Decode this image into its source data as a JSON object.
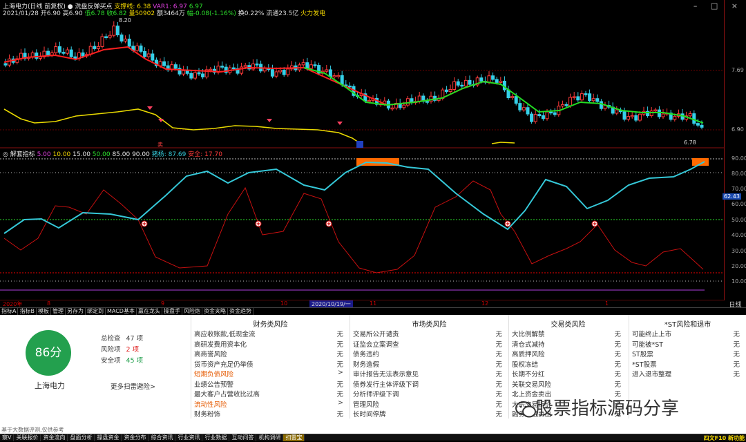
{
  "header": {
    "stock_title": "上海电力(日线 前复权)",
    "indicator1_name": "● 洗盘反弹买点",
    "support_label": "支撑线: 6.38",
    "var1_label": "VAR1: 6.97",
    "var1_value": "6.97",
    "date": "2021/01/28",
    "open": "开6.90",
    "high": "高6.90",
    "low": "低6.78",
    "close": "收6.82",
    "volume": "量50902",
    "amount": "额3464万",
    "change": "幅-0.08(-1.16%)",
    "turnover": "换0.22%",
    "float": "流通23.5亿",
    "news": "火力发电"
  },
  "window_buttons": "– □ ×",
  "price_chart": {
    "y_labels": [
      "7.69",
      "6.90"
    ],
    "high_label": "8.20",
    "low_label": "6.78",
    "axis_top": "90.00",
    "cursor_value": "62.43"
  },
  "indicator_title": {
    "name": "◎ 解套指标",
    "params": [
      "5.00",
      "10.00",
      "15.00",
      "50.00",
      "85.00",
      "90.00"
    ],
    "huanggen_label": "猪杨: 87.69",
    "anquan_label": "安全: 17.70"
  },
  "indicator_axis": [
    "90.00",
    "80.00",
    "70.00",
    "60.00",
    "50.00",
    "40.00",
    "30.00",
    "20.00",
    "10.00"
  ],
  "position_row": {
    "labels": [
      "2020年",
      "8",
      "9",
      "10",
      "11",
      "12",
      "1"
    ],
    "highlight": "2020/10/19/一",
    "day_button": "日线"
  },
  "tabs": [
    "指标A",
    "指标B",
    "模板",
    "管理",
    "另存为",
    "绑定到",
    "MACD基本",
    "赢在龙头",
    "操盘手",
    "风险炮",
    "资金夹略",
    "资金趋势"
  ],
  "risk_panel": {
    "score": "86分",
    "stock_name": "上海电力",
    "total_label": "总检查",
    "total_value": "47 项",
    "risk_label": "风险项",
    "risk_value": "2 项",
    "safe_label": "安全项",
    "safe_value": "45 项",
    "more_link": "更多扫雷避险>",
    "disclaimer": "基于大数据评测,仅供参考",
    "columns": [
      {
        "title": "财务类风险",
        "rows": [
          {
            "label": "高应收账款,低现金流",
            "value": "无"
          },
          {
            "label": "高研发费用资本化",
            "value": "无"
          },
          {
            "label": "高商誉风险",
            "value": "无"
          },
          {
            "label": "货币资产充足仍举债",
            "value": "无"
          },
          {
            "label": "短期负债风险",
            "value": ">",
            "warn": true
          },
          {
            "label": "业绩公告预警",
            "value": "无"
          },
          {
            "label": "最大客户占营收比过高",
            "value": "无"
          },
          {
            "label": "流动性风险",
            "value": ">",
            "warn": true
          },
          {
            "label": "财务粉饰",
            "value": "无"
          }
        ]
      },
      {
        "title": "市场类风险",
        "rows": [
          {
            "label": "交易所公开谴责",
            "value": "无"
          },
          {
            "label": "证监会立案调查",
            "value": "无"
          },
          {
            "label": "债务违约",
            "value": "无"
          },
          {
            "label": "财务造假",
            "value": "无"
          },
          {
            "label": "审计报告无法表示意见",
            "value": "无"
          },
          {
            "label": "债券发行主体评级下调",
            "value": "无"
          },
          {
            "label": "分析师评级下调",
            "value": "无"
          },
          {
            "label": "管理风险",
            "value": "无"
          },
          {
            "label": "长时间停牌",
            "value": "无"
          }
        ]
      },
      {
        "title": "交易类风险",
        "rows": [
          {
            "label": "大比例解禁",
            "value": "无"
          },
          {
            "label": "清仓式减持",
            "value": "无"
          },
          {
            "label": "高质押风险",
            "value": "无"
          },
          {
            "label": "股权冻结",
            "value": "无"
          },
          {
            "label": "长期不分红",
            "value": "无"
          },
          {
            "label": "关联交易风险",
            "value": "无"
          },
          {
            "label": "北上资金卖出",
            "value": "无"
          },
          {
            "label": "大宗交易折价",
            "value": "无"
          },
          {
            "label": "融券高融卖出",
            "value": "无"
          }
        ]
      },
      {
        "title": "*ST风险和退市",
        "rows": [
          {
            "label": "可能终止上市",
            "value": "无"
          },
          {
            "label": "可能被*ST",
            "value": "无"
          },
          {
            "label": "ST股票",
            "value": "无"
          },
          {
            "label": "*ST股票",
            "value": "无"
          },
          {
            "label": "进入退市整理",
            "value": "无"
          }
        ]
      }
    ]
  },
  "watermark": "股票指标源码分享",
  "bottom_tabs": [
    "察V",
    "关联报价",
    "资金流向",
    "盘面分析",
    "操盘资金",
    "资金分布",
    "综合资讯",
    "行业资讯",
    "行业数据",
    "互动问答",
    "机构调研",
    "扫雷宝"
  ],
  "bottom_active": "扫雷宝",
  "status_right": "四文F10 新功能",
  "colors": {
    "up": "#ff3b3b",
    "down": "#35d0e8",
    "ma_up": "#ff2020",
    "ma_down": "#22dd22",
    "yellow": "#f0e000",
    "risk_orange": "#ff6a00",
    "score_green": "#23a04e"
  }
}
